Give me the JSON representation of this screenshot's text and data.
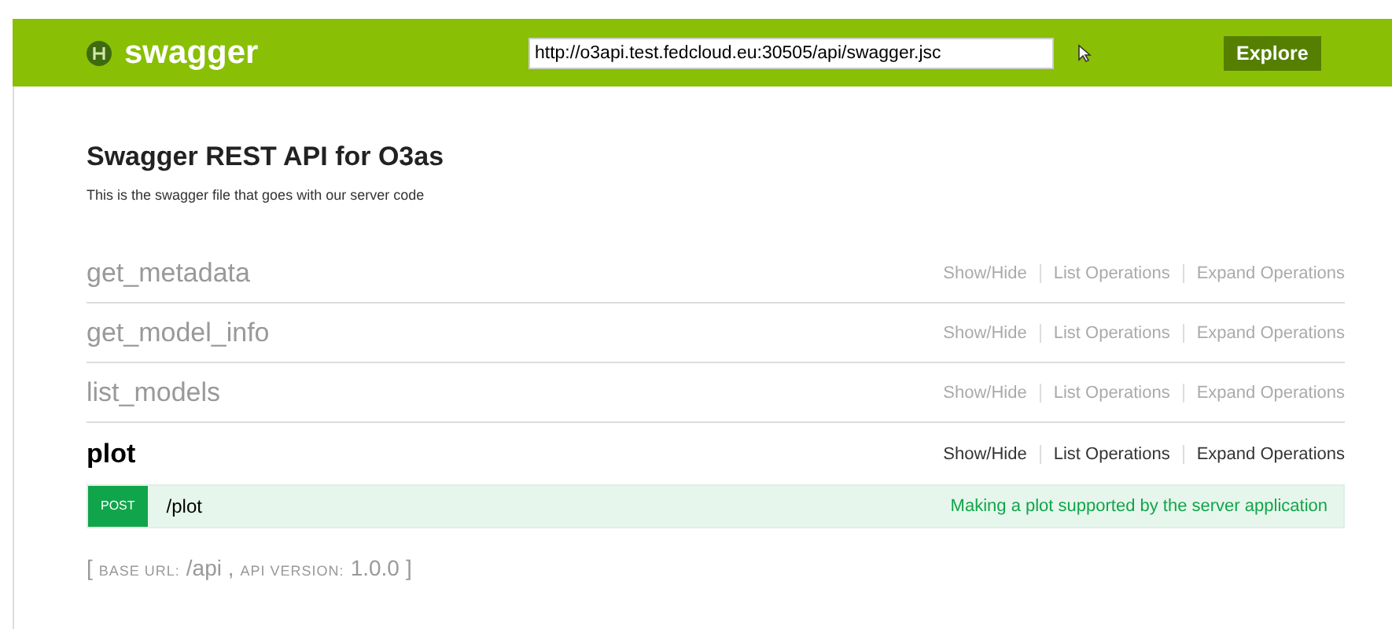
{
  "header": {
    "logo": "swagger",
    "url": "http://o3api.test.fedcloud.eu:30505/api/swagger.jsc",
    "explore": "Explore"
  },
  "info": {
    "title": "Swagger REST API for O3as",
    "description": "This is the swagger file that goes with our server code"
  },
  "resources": [
    {
      "name": "get_metadata",
      "expanded": false,
      "links": [
        "Show/Hide",
        "List Operations",
        "Expand Operations"
      ]
    },
    {
      "name": "get_model_info",
      "expanded": false,
      "links": [
        "Show/Hide",
        "List Operations",
        "Expand Operations"
      ]
    },
    {
      "name": "list_models",
      "expanded": false,
      "links": [
        "Show/Hide",
        "List Operations",
        "Expand Operations"
      ]
    },
    {
      "name": "plot",
      "expanded": true,
      "links": [
        "Show/Hide",
        "List Operations",
        "Expand Operations"
      ],
      "operations": [
        {
          "method": "POST",
          "path": "/plot",
          "summary": "Making a plot supported by the server application"
        }
      ]
    }
  ],
  "footer": [
    {
      "kind": "bracket",
      "text": "["
    },
    {
      "kind": "label",
      "text": "BASE URL:"
    },
    {
      "kind": "value",
      "text": "/api ,"
    },
    {
      "kind": "label",
      "text": "API VERSION:"
    },
    {
      "kind": "value",
      "text": "1.0.0"
    },
    {
      "kind": "bracket",
      "text": "]"
    }
  ]
}
